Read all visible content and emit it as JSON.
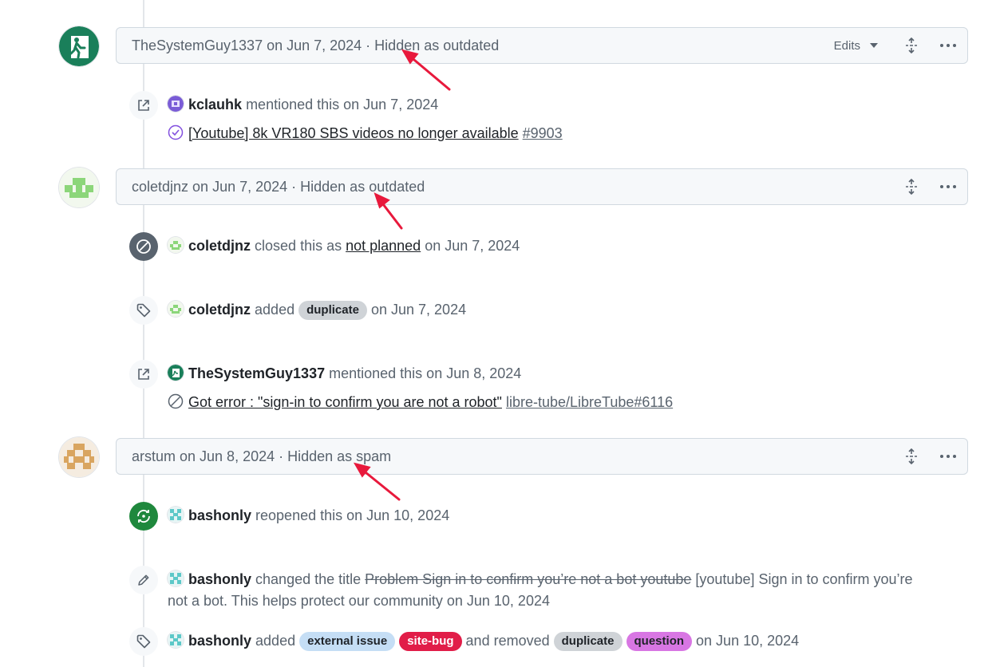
{
  "hidden_comments": [
    {
      "text": "TheSystemGuy1337 on Jun 7, 2024 · Hidden as outdated",
      "edits_label": "Edits"
    },
    {
      "text": "coletdjnz on Jun 7, 2024 · Hidden as outdated"
    },
    {
      "text": "arstum on Jun 8, 2024 · Hidden as spam"
    }
  ],
  "events": {
    "mention1": {
      "user": "kclauhk",
      "action": "mentioned this on Jun 7, 2024",
      "ref_title": "[Youtube] 8k VR180 SBS videos no longer available",
      "ref_id": "#9903"
    },
    "closed": {
      "user": "coletdjnz",
      "action_pre": "closed this as",
      "reason": "not planned",
      "action_post": "on Jun 7, 2024"
    },
    "labeled1": {
      "user": "coletdjnz",
      "action": "added",
      "label": "duplicate",
      "date": "on Jun 7, 2024"
    },
    "mention2": {
      "user": "TheSystemGuy1337",
      "action": "mentioned this on Jun 8, 2024",
      "ref_title": "Got error : \"sign-in to confirm you are not a robot\"",
      "ref_id": "libre-tube/LibreTube#6116"
    },
    "reopened": {
      "user": "bashonly",
      "action": "reopened this on Jun 10, 2024"
    },
    "renamed": {
      "user": "bashonly",
      "action": "changed the title",
      "old_title": "Problem Sign in to confirm you’re not a bot youtube",
      "new_title": "[youtube] Sign in to confirm you’re not a bot. This helps protect our community",
      "date": "on Jun 10, 2024"
    },
    "labeled2": {
      "user": "bashonly",
      "action": "added",
      "added_labels": [
        "external issue",
        "site-bug"
      ],
      "removed_text": "and removed",
      "removed_labels": [
        "duplicate",
        "question"
      ],
      "date": "on Jun 10, 2024"
    }
  },
  "colors": {
    "label_external_issue": "#c5def5",
    "label_site_bug": "#e11d48",
    "label_duplicate": "#cfd3d7",
    "label_question": "#d876e3",
    "annotation_arrow": "#e8193c"
  }
}
